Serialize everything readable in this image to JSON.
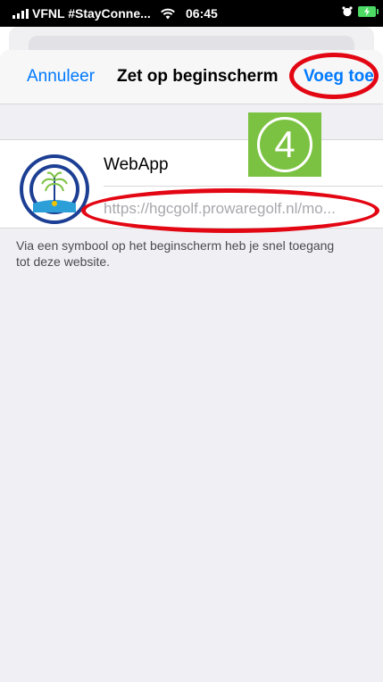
{
  "status_bar": {
    "carrier": "VFNL #StayConne...",
    "time": "06:45"
  },
  "navbar": {
    "cancel_label": "Annuleer",
    "title": "Zet op beginscherm",
    "add_label": "Voeg toe"
  },
  "bookmark": {
    "name": "WebApp",
    "url": "https://hgcgolf.prowaregolf.nl/mo..."
  },
  "step_badge": "4",
  "footnote": "Via een symbool op het beginscherm heb je snel toegang tot deze website.",
  "colors": {
    "accent": "#007aff",
    "annotation_red": "#e30613",
    "badge_green": "#7cc242",
    "logo_navy": "#1c3f94"
  }
}
